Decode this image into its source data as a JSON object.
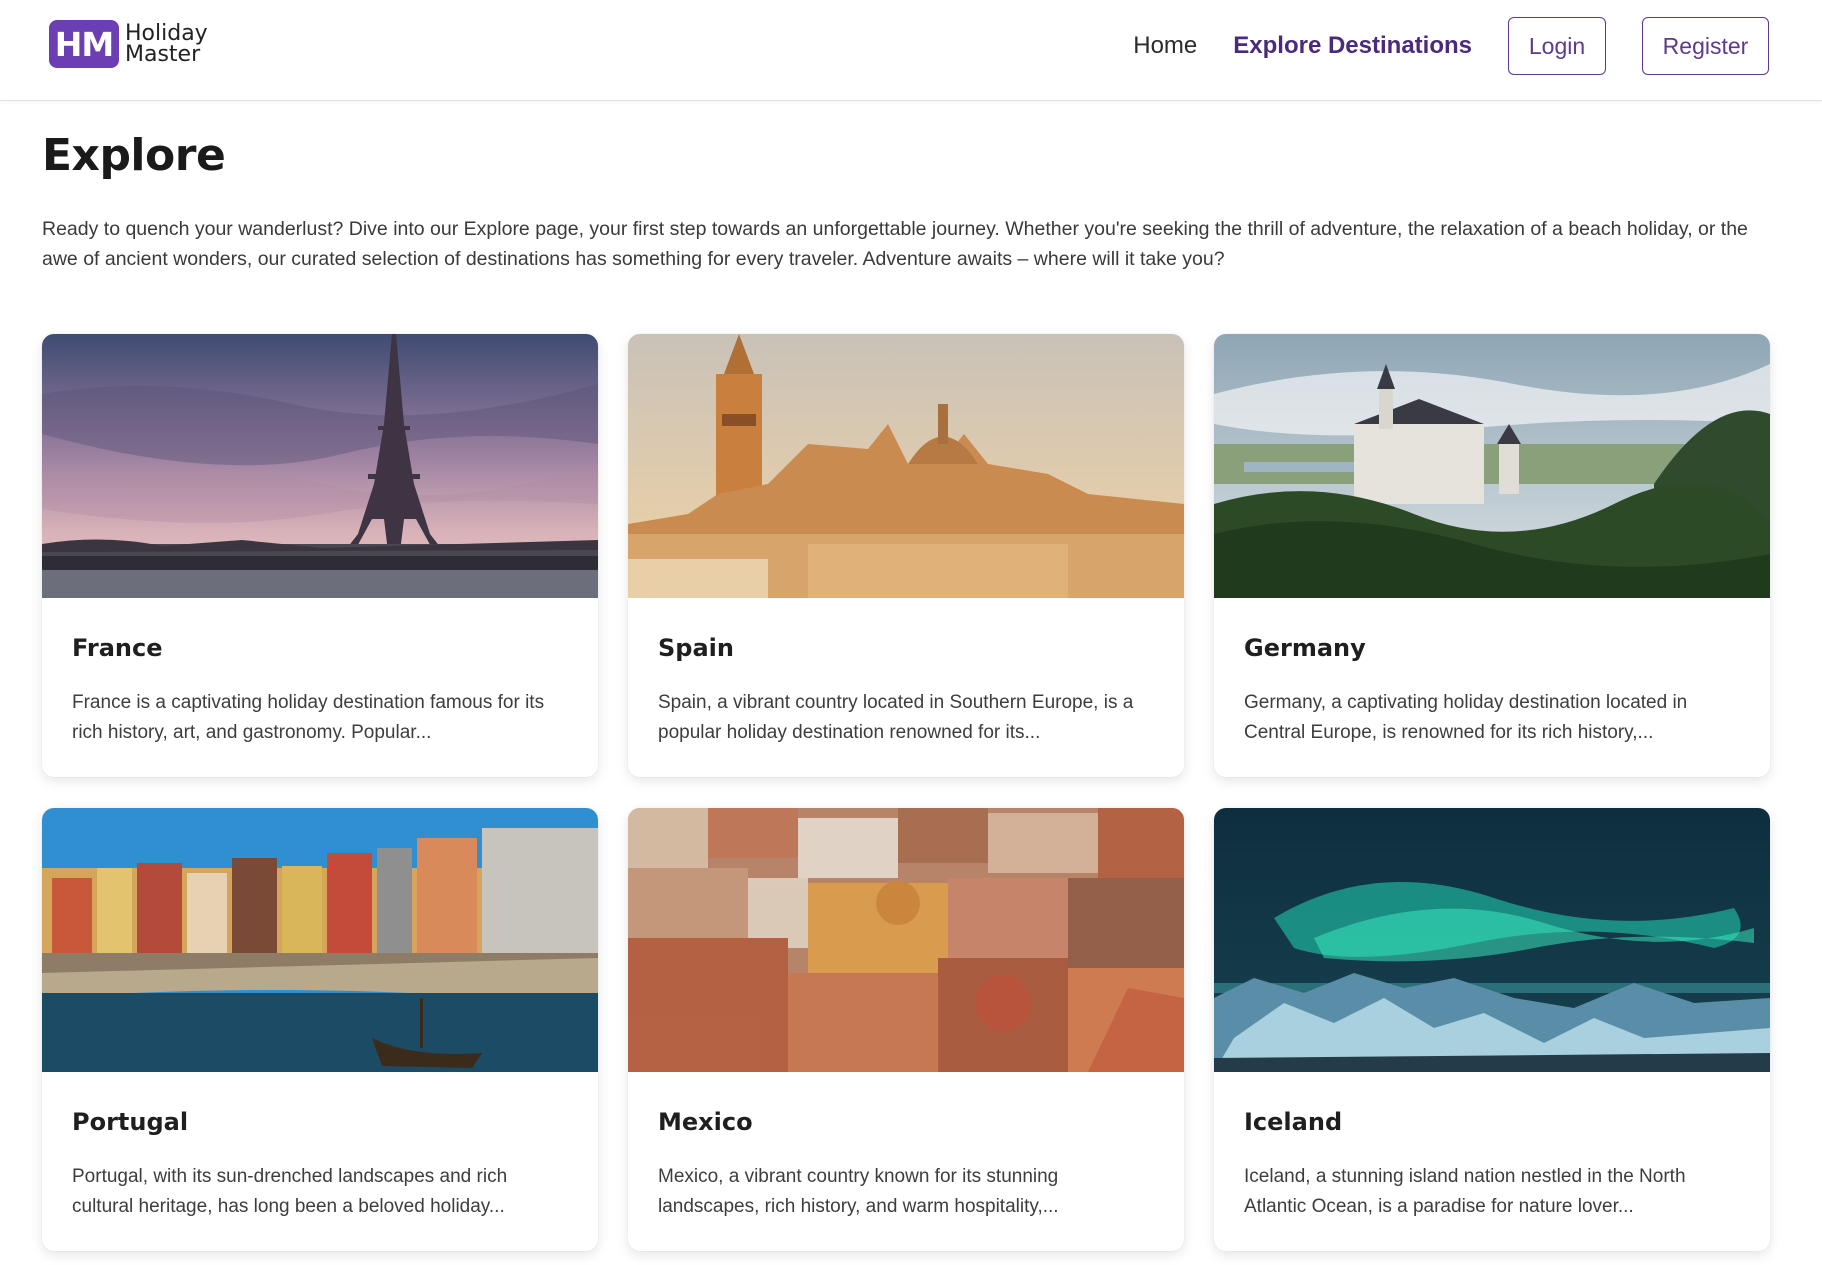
{
  "header": {
    "logo_mark": "HM",
    "logo_line1": "Holiday",
    "logo_line2": "Master",
    "nav": {
      "home": "Home",
      "explore": "Explore Destinations"
    },
    "login": "Login",
    "register": "Register"
  },
  "main": {
    "title": "Explore",
    "intro": "Ready to quench your wanderlust? Dive into our Explore page, your first step towards an unforgettable journey. Whether you're seeking the thrill of adventure, the relaxation of a beach holiday, or the awe of ancient wonders, our curated selection of destinations has something for every traveler. Adventure awaits – where will it take you?"
  },
  "destinations": [
    {
      "name": "France",
      "description": "France is a captivating holiday destination famous for its rich history, art, and gastronomy. Popular...",
      "image": "eiffel-tower-photo"
    },
    {
      "name": "Spain",
      "description": "Spain, a vibrant country located in Southern Europe, is a popular holiday destination renowned for its...",
      "image": "seville-cathedral-photo"
    },
    {
      "name": "Germany",
      "description": "Germany, a captivating holiday destination located in Central Europe, is renowned for its rich history,...",
      "image": "neuschwanstein-castle-photo"
    },
    {
      "name": "Portugal",
      "description": "Portugal, with its sun-drenched landscapes and rich cultural heritage, has long been a beloved holiday...",
      "image": "porto-riverside-photo"
    },
    {
      "name": "Mexico",
      "description": "Mexico, a vibrant country known for its stunning landscapes, rich history, and warm hospitality,...",
      "image": "guanajuato-city-photo"
    },
    {
      "name": "Iceland",
      "description": "Iceland, a stunning island nation nestled in the North Atlantic Ocean, is a paradise for nature lover...",
      "image": "aurora-borealis-photo"
    }
  ],
  "colors": {
    "brand": "#6b3fb3",
    "nav_active": "#4b2a7b",
    "button_border": "#5d3a8e"
  }
}
